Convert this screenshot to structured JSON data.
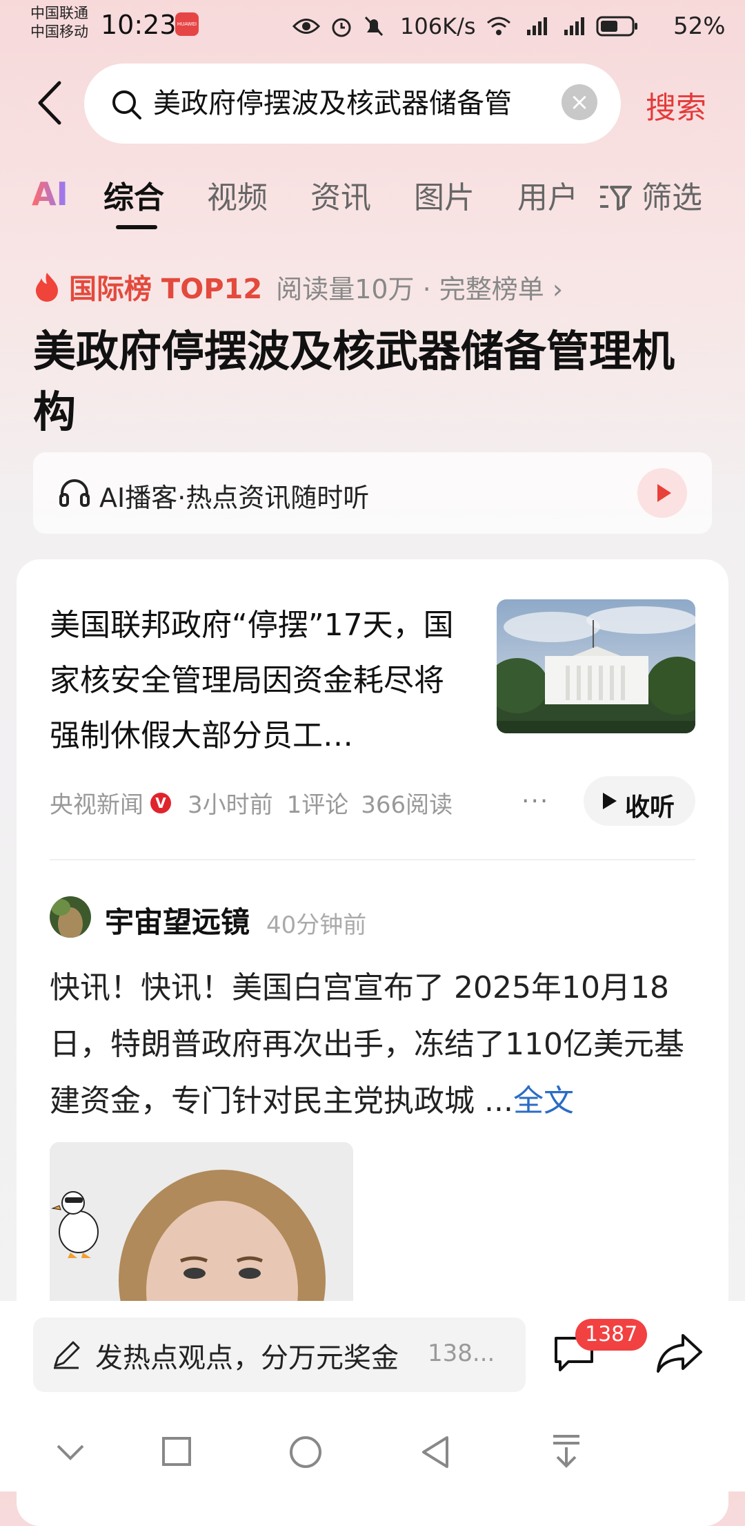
{
  "status_bar": {
    "carrier1": "中国联通",
    "carrier2": "中国移动",
    "time": "10:23",
    "net_speed": "106K/s",
    "signal1": "4G",
    "signal2": "4G",
    "battery": "52%"
  },
  "search": {
    "query": "美政府停摆波及核武器储备管",
    "button_label": "搜索"
  },
  "tabs": [
    {
      "label": "综合",
      "active": true
    },
    {
      "label": "视频"
    },
    {
      "label": "资讯"
    },
    {
      "label": "图片"
    },
    {
      "label": "用户"
    },
    {
      "label": "筛选"
    }
  ],
  "ai_tab": "AI",
  "hot_rank": {
    "label": "国际榜 TOP12",
    "meta": "阅读量10万 · 完整榜单 ›"
  },
  "page_title": "美政府停摆波及核武器储备管理机构",
  "podcast": {
    "label": "AI播客·热点资讯随时听"
  },
  "news_item": {
    "title": "美国联邦政府“停摆”17天，国家核安全管理局因资金耗尽将强制休假大部分员工…",
    "source": "央视新闻",
    "badge": "V",
    "time": "3小时前",
    "comments": "1评论",
    "reads": "366阅读",
    "more": "···",
    "listen": "收听"
  },
  "post": {
    "author": "宇宙望远镜",
    "time": "40分钟前",
    "body": "快讯！快讯！美国白宫宣布了 2025年10月18日，特朗普政府再次出手，冻结了110亿美元基建资金，专门针对民主党执政城 ...",
    "full_link": "全文"
  },
  "comment_bar": {
    "placeholder": "发热点观点，分万元奖金",
    "hint": "138...",
    "count": "1387"
  },
  "colors": {
    "accent": "#e33b3b",
    "link": "#2b6cc4",
    "badge": "#f24141"
  }
}
